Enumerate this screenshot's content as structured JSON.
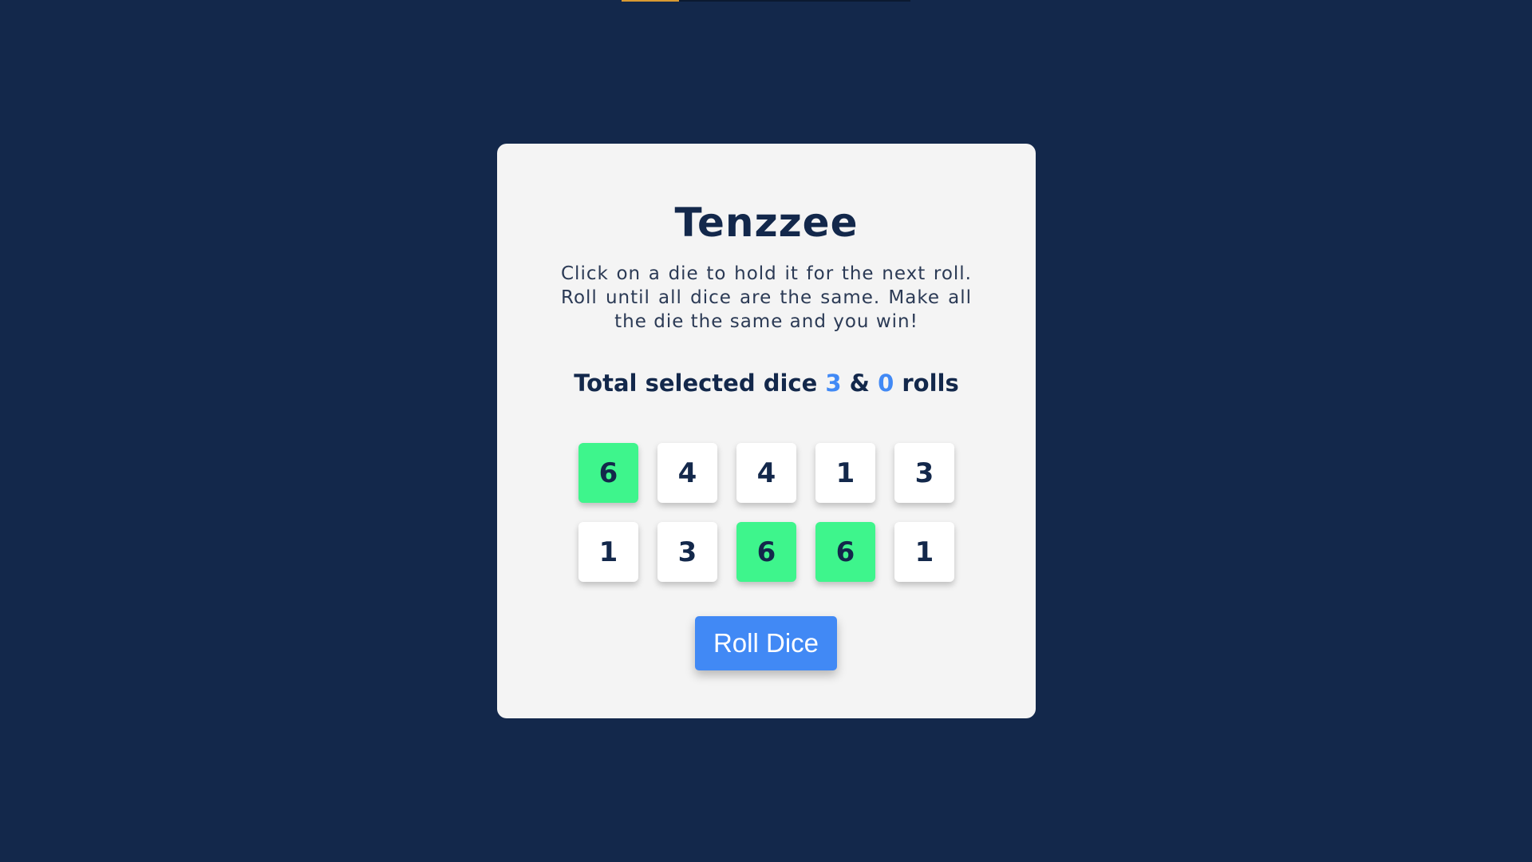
{
  "progress": {
    "fraction": 0.2,
    "fill_color": "#d99a32"
  },
  "game": {
    "title": "Tenzzee",
    "instructions": "Click on a die to hold it for the next roll. Roll until all dice are the same. Make all the die the same and you win!",
    "stats": {
      "prefix": "Total selected dice",
      "selected_count": "3",
      "separator": "&",
      "roll_count": "0",
      "suffix": "rolls"
    },
    "dice": [
      {
        "value": "6",
        "held": true
      },
      {
        "value": "4",
        "held": false
      },
      {
        "value": "4",
        "held": false
      },
      {
        "value": "1",
        "held": false
      },
      {
        "value": "3",
        "held": false
      },
      {
        "value": "1",
        "held": false
      },
      {
        "value": "3",
        "held": false
      },
      {
        "value": "6",
        "held": true
      },
      {
        "value": "6",
        "held": true
      },
      {
        "value": "1",
        "held": false
      }
    ],
    "roll_button_label": "Roll Dice"
  },
  "colors": {
    "background": "#13284b",
    "card": "#f4f4f4",
    "held_die": "#3ef58c",
    "accent": "#4189f5",
    "text": "#13284b"
  }
}
